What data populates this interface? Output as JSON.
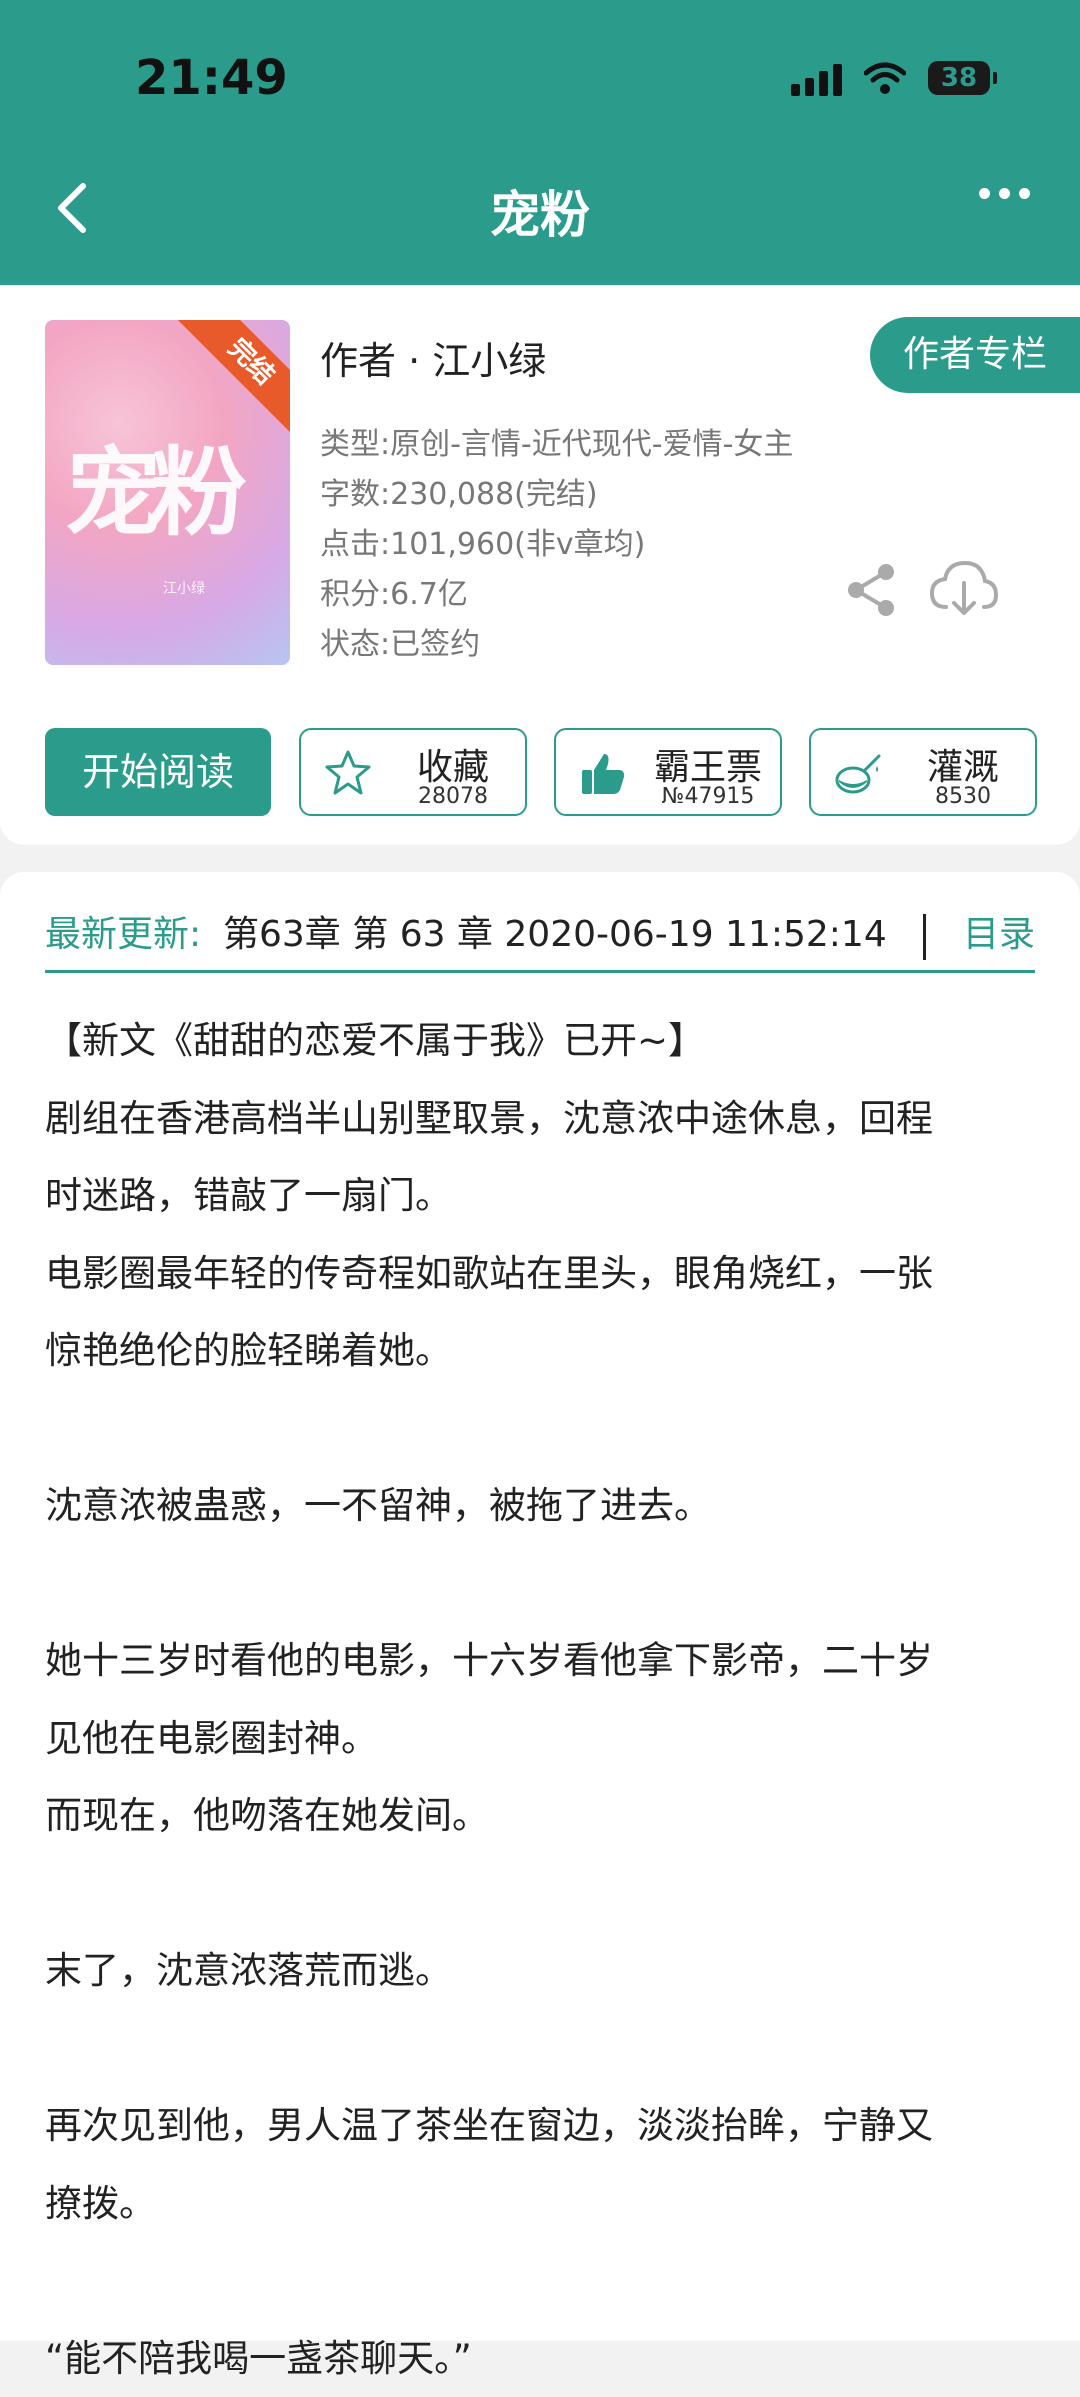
{
  "status": {
    "time": "21:49",
    "battery": "38"
  },
  "nav": {
    "title": "宠粉"
  },
  "book": {
    "cover_title": "宠粉",
    "cover_sub": "江小绿",
    "badge": "完结",
    "author": "作者 · 江小绿",
    "author_column_label": "作者专栏",
    "meta": [
      "类型:原创-言情-近代现代-爱情-女主",
      "字数:230,088(完结)",
      "点击:101,960(非v章均)",
      "积分:6.7亿",
      "状态:已签约"
    ]
  },
  "actions": {
    "start_reading": "开始阅读",
    "favorite": {
      "label": "收藏",
      "count": "28078"
    },
    "vote": {
      "label": "霸王票",
      "count": "№47915"
    },
    "water": {
      "label": "灌溉",
      "count": "8530"
    }
  },
  "update": {
    "label": "最新更新:",
    "text": "第63章 第 63 章 2020-06-19 11:52:14",
    "toc": "目录"
  },
  "description": [
    "【新文《甜甜的恋爱不属于我》已开~】",
    "剧组在香港高档半山别墅取景，沈意浓中途休息，回程",
    "时迷路，错敲了一扇门。",
    "电影圈最年轻的传奇程如歌站在里头，眼角烧红，一张",
    "惊艳绝伦的脸轻睇着她。",
    "",
    "沈意浓被蛊惑，一不留神，被拖了进去。",
    "",
    "她十三岁时看他的电影，十六岁看他拿下影帝，二十岁",
    "见他在电影圈封神。",
    "而现在，他吻落在她发间。",
    "",
    "末了，沈意浓落荒而逃。",
    "",
    "再次见到他，男人温了茶坐在窗边，淡淡抬眸，宁静又",
    "撩拨。",
    "",
    "“能不陪我喝一盏茶聊天。”"
  ]
}
